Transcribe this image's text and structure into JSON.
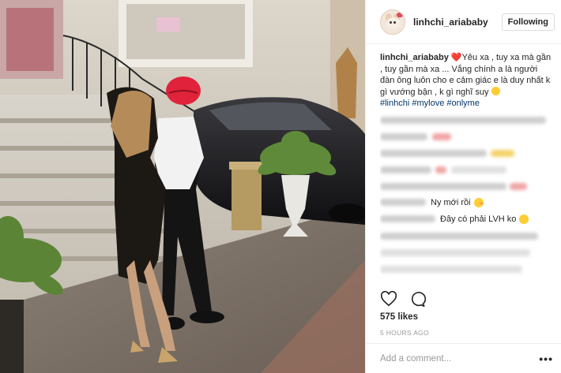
{
  "post": {
    "username": "linhchi_ariababy",
    "follow_label": "Following",
    "caption": {
      "username": "linhchi_ariababy",
      "heart": "❤️",
      "text": "Yêu xa , tuy xa mà gần , tuy gần mà xa ... Vắng chính a là người đàn ông luôn cho e cảm giác e là duy nhất k gì vướng bận , k gì nghĩ suy",
      "hashtags": "#linhchi #mylove #onlyme"
    },
    "visible_comments": [
      {
        "text": "Ny mới rồi"
      },
      {
        "text": "Đây có phải LVH ko"
      }
    ],
    "likes": "575 likes",
    "time": "5 HOURS AGO",
    "comment_placeholder": "Add a comment...",
    "more_label": "•••"
  },
  "icons": {
    "like": "heart-icon",
    "comment": "comment-bubble-icon",
    "more": "more-options-icon",
    "avatar": "bunny-avatar"
  },
  "colors": {
    "hashtag": "#003569",
    "heart": "#ed4956",
    "muted": "#999999",
    "border": "#efefef"
  }
}
